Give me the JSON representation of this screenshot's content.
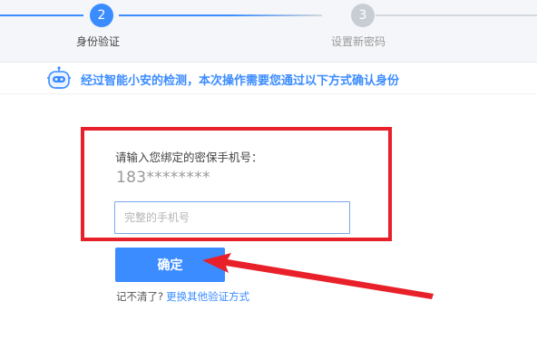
{
  "stepper": {
    "steps": [
      {
        "number": "2",
        "label": "身份验证",
        "state": "active"
      },
      {
        "number": "3",
        "label": "设置新密码",
        "state": "inactive"
      }
    ],
    "active_color": "#3b8cff",
    "inactive_color": "#c8ccd3"
  },
  "notice": {
    "icon": "robot-icon",
    "text": "经过智能小安的检测，本次操作需要您通过以下方式确认身份"
  },
  "verify": {
    "prompt": "请输入您绑定的密保手机号：",
    "masked_phone": "183********",
    "input_value": "",
    "input_placeholder": "完整的手机号",
    "confirm_label": "确定",
    "forgot_text": "记不清了?",
    "switch_link": "更换其他验证方式"
  },
  "annotation": {
    "highlight_color": "#e8202a",
    "arrow_icon": "red-arrow-icon"
  }
}
